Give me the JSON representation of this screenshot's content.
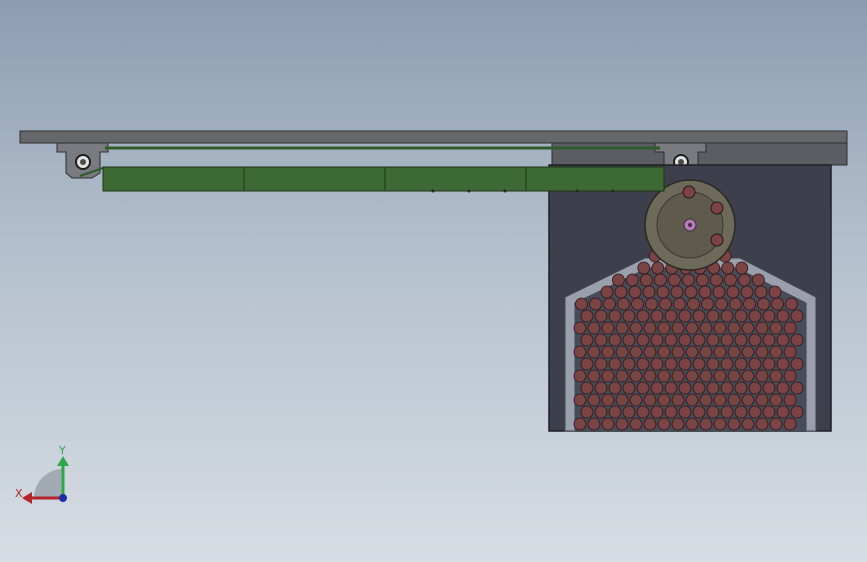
{
  "viewport": {
    "background_top": "#8c9db2",
    "background_bottom": "#d7dde3"
  },
  "model": {
    "frame_color": "#5f6066",
    "conveyor_color": "#3f6a35",
    "hopper_color": "#3d3e4a",
    "ball_color": "#7a4344",
    "wheel_color": "#6e6a5a"
  },
  "triad": {
    "x_label": "X",
    "y_label": "Y",
    "x_color": "#b3262b",
    "y_color": "#2fa64a",
    "z_color": "#1d2fa8"
  }
}
